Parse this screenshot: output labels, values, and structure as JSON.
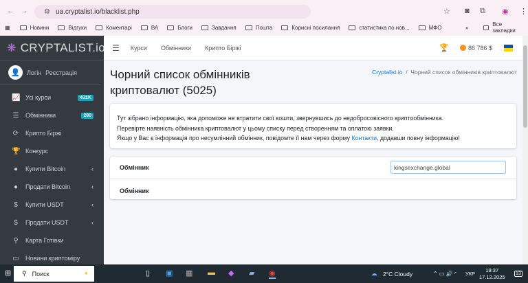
{
  "browser": {
    "url": "ua.cryptalist.io/blacklist.php",
    "bookmarks": [
      "Новини",
      "Відгуки",
      "Коментарі",
      "ВА",
      "Блоги",
      "Завдання",
      "Пошта",
      "Корисні посилання",
      "статистика по нов...",
      "МФО"
    ],
    "all_bookmarks": "Все закладки"
  },
  "sidebar": {
    "brand": "CRYPTALIST.io",
    "login": "Логін",
    "register": "Реєстрація",
    "items": [
      {
        "label": "Усі курси",
        "icon": "chart-icon",
        "glyph": "📈",
        "badge": "431K"
      },
      {
        "label": "Обмінники",
        "icon": "list-icon",
        "glyph": "☰",
        "badge": "280"
      },
      {
        "label": "Крипто Біржі",
        "icon": "sync-icon",
        "glyph": "⟳"
      },
      {
        "label": "Конкурс",
        "icon": "trophy-icon",
        "glyph": "🏆"
      },
      {
        "label": "Купити Bitcoin",
        "icon": "bitcoin-icon",
        "glyph": "●",
        "chevron": true
      },
      {
        "label": "Продати Bitcoin",
        "icon": "bitcoin-icon",
        "glyph": "●",
        "chevron": true
      },
      {
        "label": "Купити USDT",
        "icon": "dollar-icon",
        "glyph": "$",
        "chevron": true
      },
      {
        "label": "Продати USDT",
        "icon": "dollar-icon",
        "glyph": "$",
        "chevron": true
      },
      {
        "label": "Карта Готівки",
        "icon": "map-marker-icon",
        "glyph": "⚲"
      },
      {
        "label": "Новини криптоміру",
        "icon": "newspaper-icon",
        "glyph": "▭"
      }
    ]
  },
  "topnav": {
    "links": [
      "Курси",
      "Обмінники",
      "Крипто Біржі"
    ],
    "balance": "86 786 $"
  },
  "page": {
    "title": "Чорний список обмінників криптовалют (5025)",
    "breadcrumb_home": "Cryptalist.io",
    "breadcrumb_current": "Чорний список обмінників криптовалют",
    "info_line1": "Тут зібрано інформацію, яка допоможе не втратити свої кошти, звернувшись до недобросовісного криптообмінника.",
    "info_line2": "Перевірте наявність обмінника криптовалют у цьому списку перед створенням та оплатою заявки.",
    "info_line3a": "Якщо у Вас є інформація про несумлінний обмінник, повідомте її нам через форму ",
    "info_link": "Контакти",
    "info_line3b": ", додавши повну інформацію!",
    "col_header": "Обмінник",
    "filter_value": "kingsexchange.global",
    "row_label": "Обмінник"
  },
  "taskbar": {
    "search": "Поиск",
    "weather": "2°C  Cloudy",
    "lang": "УКР",
    "time": "19:37",
    "date": "17.12.2025",
    "notifications": "13"
  }
}
